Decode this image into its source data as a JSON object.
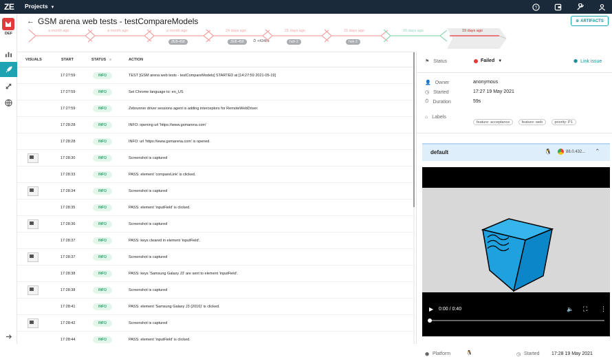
{
  "app": {
    "logo": "ZE",
    "projects_label": "Projects"
  },
  "topbar_icons": [
    "help-icon",
    "wallet-icon",
    "wrench-icon",
    "user-icon"
  ],
  "sidebar": {
    "project_label": "DEF",
    "items": [
      "dashboard-icon",
      "rocket-icon",
      "satellite-icon",
      "globe-icon",
      "expand-icon"
    ]
  },
  "header": {
    "title": "GSM arena web tests - testCompareModels",
    "artifacts_label": "ARTIFACTS"
  },
  "history": [
    {
      "time": "a month ago",
      "tag": "",
      "extra": "",
      "color": "#f4a6a6"
    },
    {
      "time": "a month ago",
      "tag": "",
      "extra": "",
      "color": "#f4a6a6"
    },
    {
      "time": "a month ago",
      "tag": "ZEB-458",
      "extra": "",
      "color": "#f4a6a6"
    },
    {
      "time": "24 days ago",
      "tag": "ZEB-458",
      "extra": "+434%",
      "color": "#f4a6a6"
    },
    {
      "time": "21 days ago",
      "tag": "hoh-2",
      "extra": "",
      "color": "#f4a6a6"
    },
    {
      "time": "21 days ago",
      "tag": "hoh-2",
      "extra": "",
      "color": "#f4a6a6"
    },
    {
      "time": "20 days ago",
      "tag": "",
      "extra": "",
      "color": "#8fd9b8"
    },
    {
      "time": "19 days ago",
      "tag": "",
      "extra": "",
      "color": "#e53935"
    }
  ],
  "log_table": {
    "headers": {
      "visuals": "VISUALS",
      "start": "START",
      "status": "STATUS",
      "action": "ACTION"
    },
    "rows": [
      {
        "time": "17:27:59",
        "status": "INFO",
        "action": "TEST [GSM arena web tests - testCompareModels] STARTED at [14:27:59 2021-05-19]",
        "thumb": false
      },
      {
        "time": "17:27:59",
        "status": "INFO",
        "action": "Set Chrome language to: en_US",
        "thumb": false
      },
      {
        "time": "17:27:59",
        "status": "INFO",
        "action": "Zebrunner driver sessions agent is adding interceptors for RemoteWebDriver.",
        "thumb": false
      },
      {
        "time": "17:28:28",
        "status": "INFO",
        "action": "INFO: opening url 'https://www.gsmarena.com'",
        "thumb": false
      },
      {
        "time": "17:28:28",
        "status": "INFO",
        "action": "INFO: url 'https://www.gsmarena.com' is opened.",
        "thumb": false
      },
      {
        "time": "17:28:30",
        "status": "INFO",
        "action": "Screenshot is captured",
        "thumb": true
      },
      {
        "time": "17:28:33",
        "status": "INFO",
        "action": "PASS: element 'compareLink' is clicked.",
        "thumb": false
      },
      {
        "time": "17:28:34",
        "status": "INFO",
        "action": "Screenshot is captured",
        "thumb": true
      },
      {
        "time": "17:28:35",
        "status": "INFO",
        "action": "PASS: element 'inputField' is clicked.",
        "thumb": false
      },
      {
        "time": "17:28:36",
        "status": "INFO",
        "action": "Screenshot is captured",
        "thumb": true
      },
      {
        "time": "17:28:37",
        "status": "INFO",
        "action": "PASS: keys cleared in element 'inputField'.",
        "thumb": false
      },
      {
        "time": "17:28:37",
        "status": "INFO",
        "action": "Screenshot is captured",
        "thumb": true
      },
      {
        "time": "17:28:38",
        "status": "INFO",
        "action": "PASS: keys 'Samsung Galaxy J3' are sent to element 'inputField'.",
        "thumb": false
      },
      {
        "time": "17:28:38",
        "status": "INFO",
        "action": "Screenshot is captured",
        "thumb": true
      },
      {
        "time": "17:28:41",
        "status": "INFO",
        "action": "PASS: element 'Samsung Galaxy J3 (2016)' is clicked.",
        "thumb": false
      },
      {
        "time": "17:28:42",
        "status": "INFO",
        "action": "Screenshot is captured",
        "thumb": true
      },
      {
        "time": "17:28:44",
        "status": "INFO",
        "action": "PASS: element 'inputField' is clicked.",
        "thumb": false
      }
    ]
  },
  "details": {
    "status_label": "Status",
    "status_value": "Failed",
    "link_issue": "Link issue",
    "owner_label": "Owner",
    "owner_value": "anonymous",
    "started_label": "Started",
    "started_value": "17:27 19 May 2021",
    "duration_label": "Duration",
    "duration_value": "59s",
    "labels_label": "Labels",
    "labels": [
      "feature: acceptance",
      "feature: web",
      "priority: P1"
    ]
  },
  "environment": {
    "name": "default",
    "browser_version": "88.0.432..."
  },
  "video": {
    "time": "0:00 / 0:40",
    "progress": 0
  },
  "bottom": {
    "platform_label": "Platform",
    "started_label": "Started",
    "started_value": "17:28 19 May 2021"
  },
  "colors": {
    "brand": "#1ea3b3",
    "failed": "#e53935",
    "info": "#2aa56b",
    "topbar": "#1b2a3a"
  }
}
